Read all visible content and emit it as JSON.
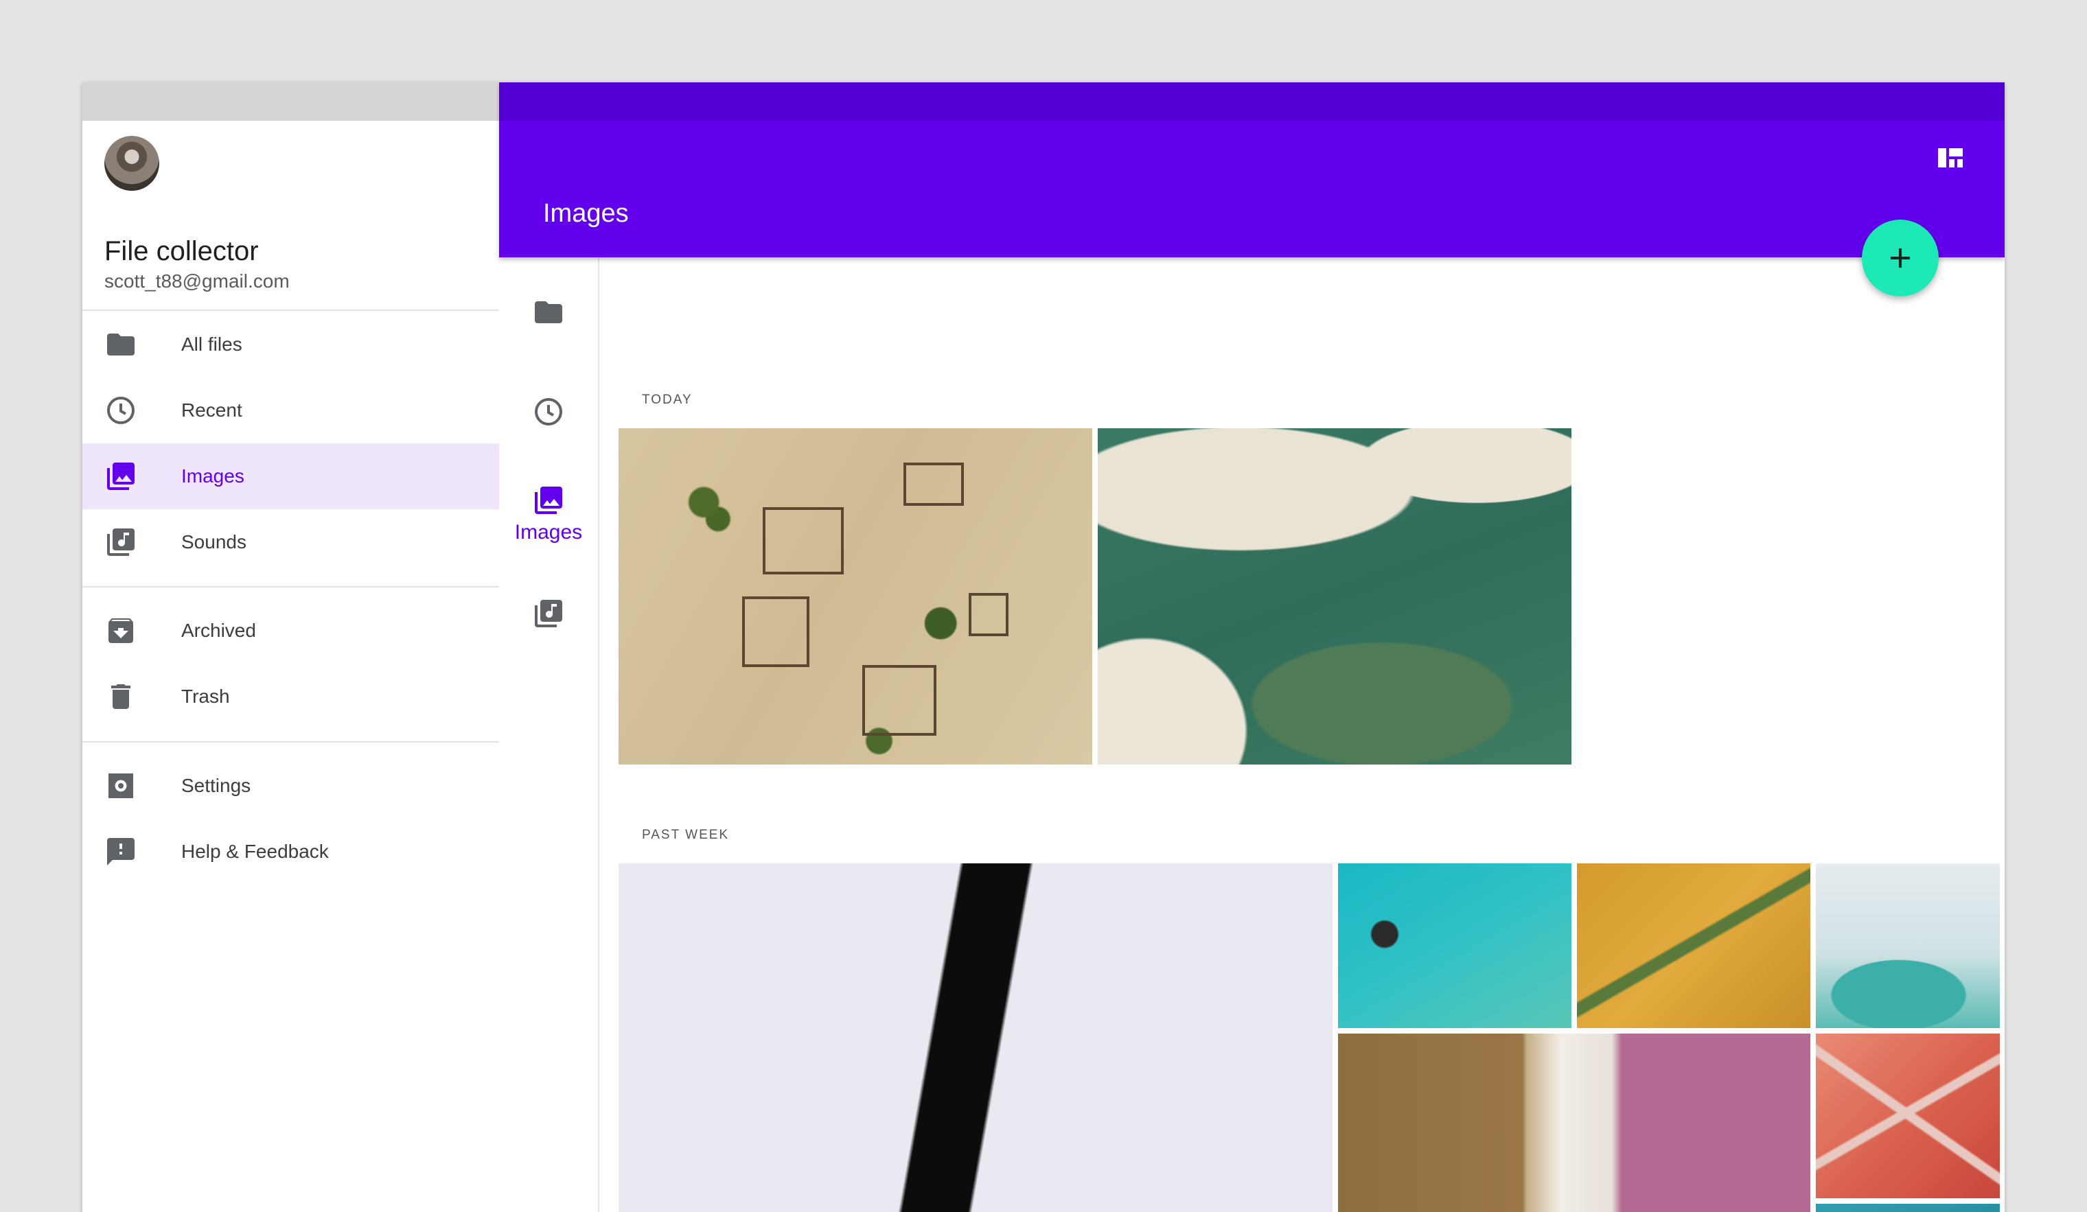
{
  "drawer": {
    "title": "File collector",
    "email": "scott_t88@gmail.com",
    "items": [
      {
        "label": "All files",
        "icon": "folder-icon"
      },
      {
        "label": "Recent",
        "icon": "clock-icon"
      },
      {
        "label": "Images",
        "icon": "images-icon",
        "active": true
      },
      {
        "label": "Sounds",
        "icon": "library-music-icon"
      },
      {
        "label": "Archived",
        "icon": "archive-icon"
      },
      {
        "label": "Trash",
        "icon": "trash-icon"
      },
      {
        "label": "Settings",
        "icon": "settings-icon"
      },
      {
        "label": "Help & Feedback",
        "icon": "feedback-icon"
      }
    ]
  },
  "appbar": {
    "title": "Images",
    "layout_icon": "dashboard-icon",
    "fab_icon": "plus-icon"
  },
  "rail": {
    "items": [
      {
        "icon": "folder-icon"
      },
      {
        "icon": "clock-icon"
      },
      {
        "icon": "images-icon",
        "label": "Images",
        "active": true
      },
      {
        "icon": "library-music-icon"
      }
    ]
  },
  "content": {
    "sections": [
      {
        "label": "TODAY"
      },
      {
        "label": "PAST WEEK"
      }
    ]
  },
  "colors": {
    "primary": "#6200ee",
    "primary_dark": "#5600d8",
    "accent": "#1de9b6",
    "active_bg": "#efe5fd",
    "icon_grey": "#5f6368"
  }
}
